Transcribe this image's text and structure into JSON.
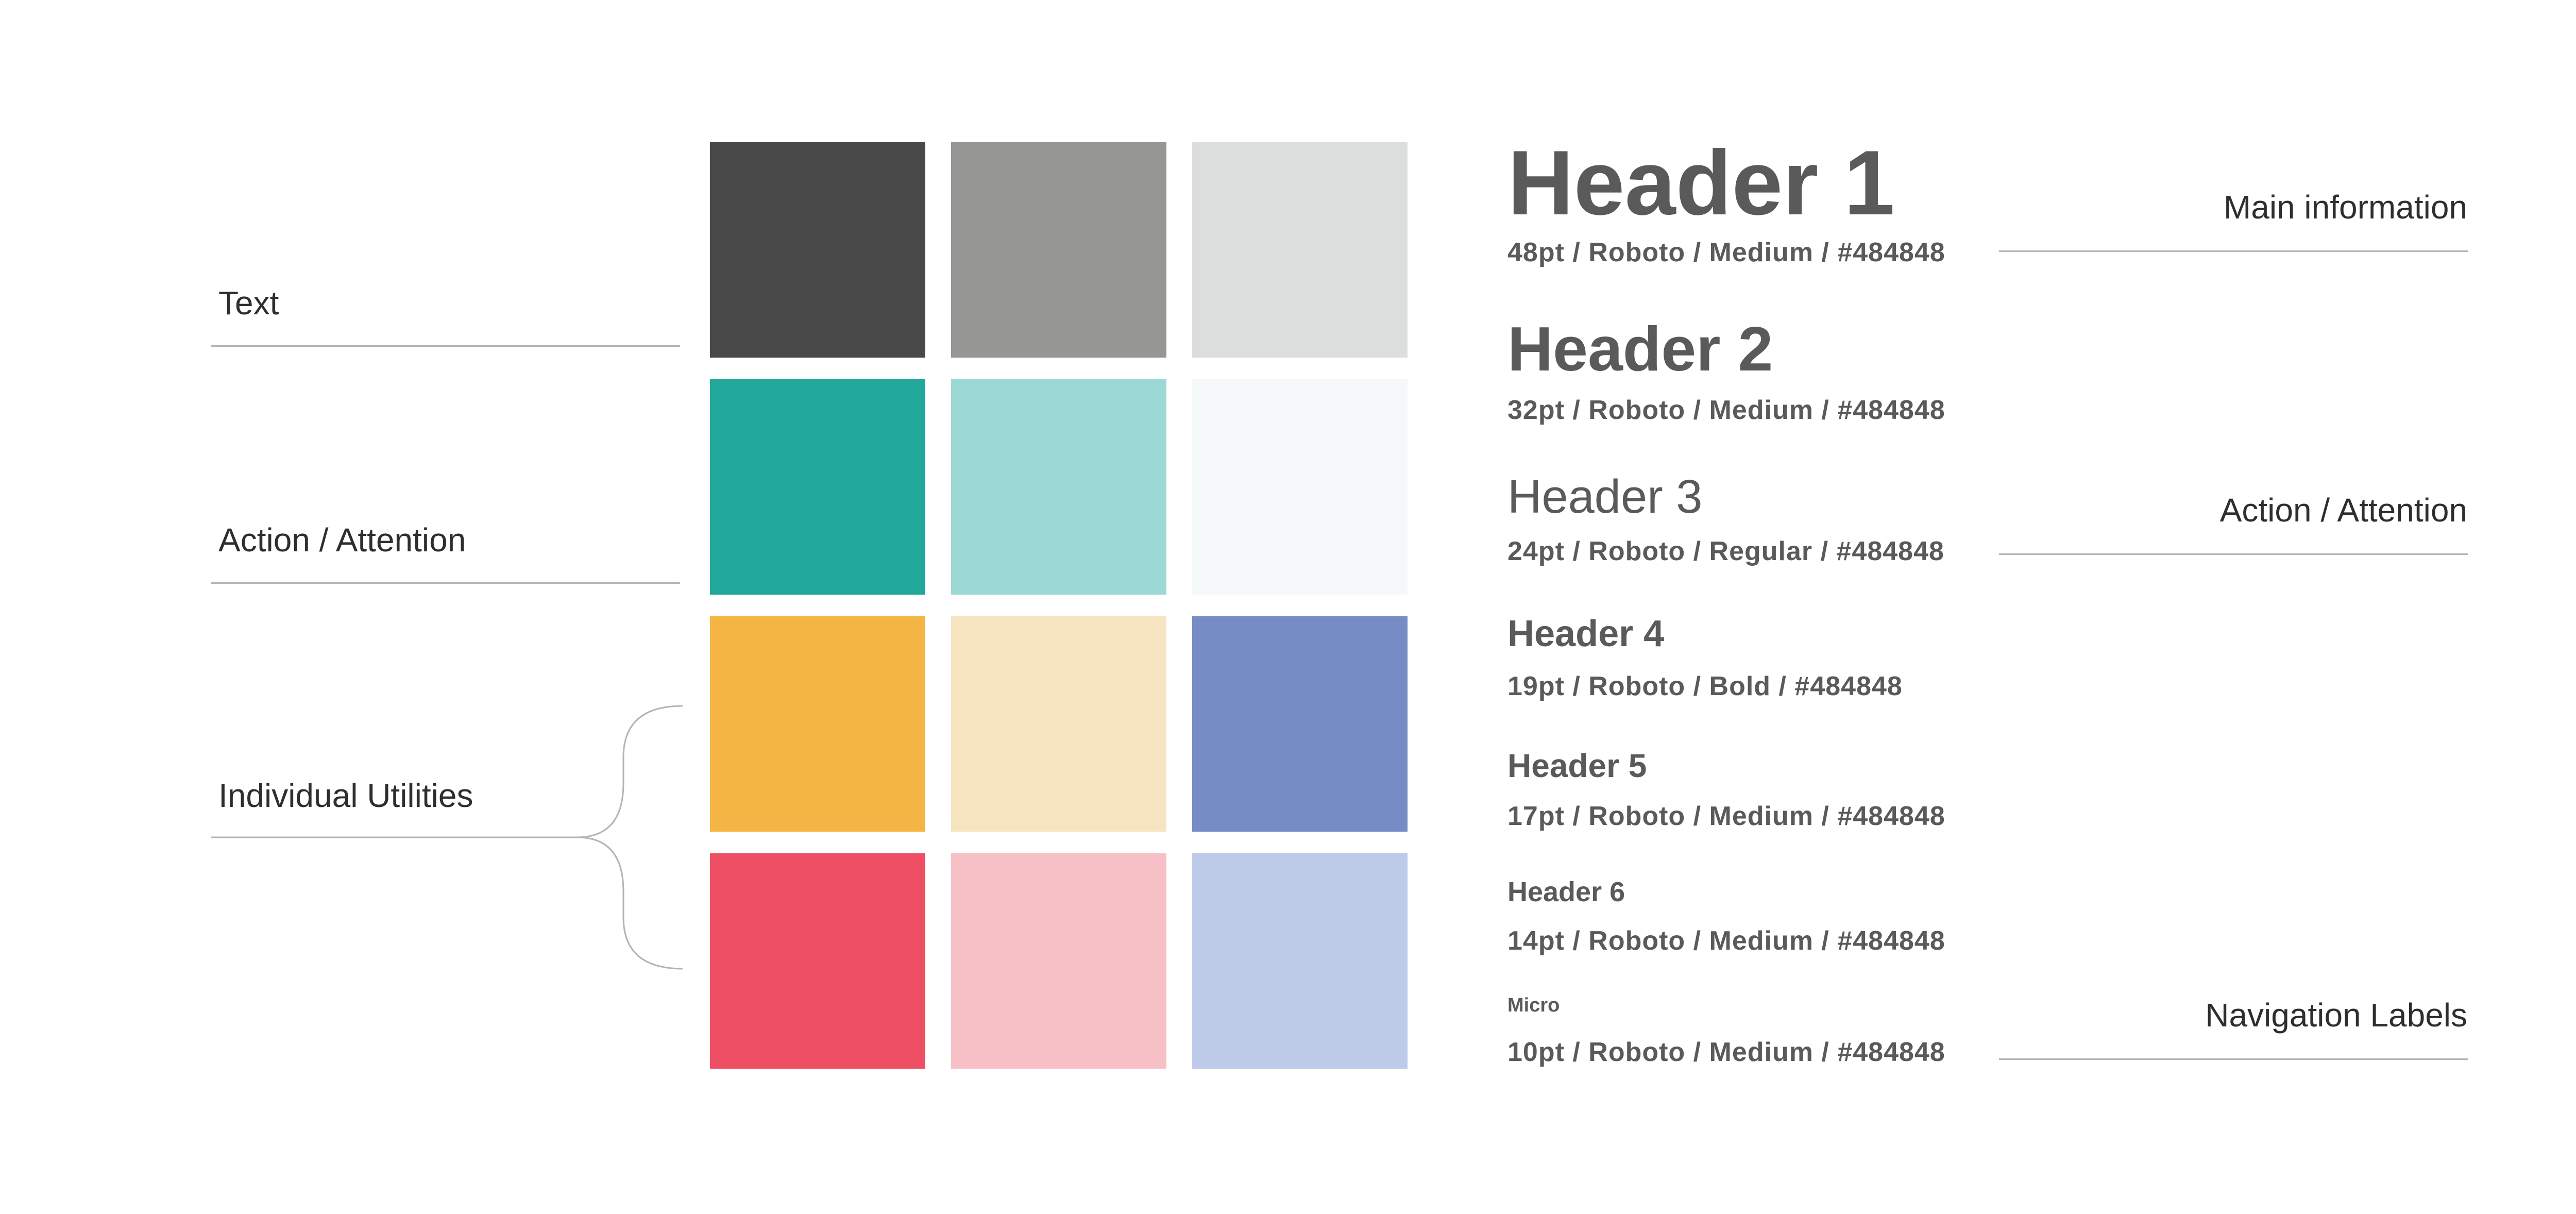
{
  "color_groups": {
    "text_label": "Text",
    "action_label": "Action / Attention",
    "utilities_label": "Individual Utilities"
  },
  "swatches": [
    [
      "#494949",
      "#969695",
      "#dcdedd"
    ],
    [
      "#22a89b",
      "#9cd9d6",
      "#f5f9f9"
    ],
    [
      "#f5b544",
      "#f6e5c0",
      "#758dc4"
    ],
    [
      "#ef4f64",
      "#f7c0c6",
      "#becbe8"
    ]
  ],
  "typography": [
    {
      "sample": "Header 1",
      "meta": "48pt / Roboto / Medium / #484848"
    },
    {
      "sample": "Header 2",
      "meta": "32pt / Roboto / Medium / #484848"
    },
    {
      "sample": "Header 3",
      "meta": "24pt / Roboto / Regular / #484848"
    },
    {
      "sample": "Header 4",
      "meta": "19pt / Roboto / Bold / #484848"
    },
    {
      "sample": "Header 5",
      "meta": "17pt / Roboto / Medium / #484848"
    },
    {
      "sample": "Header 6",
      "meta": "14pt / Roboto / Medium / #484848"
    },
    {
      "sample": "Micro",
      "meta": "10pt / Roboto / Medium / #484848"
    }
  ],
  "usage_labels": {
    "main": "Main information",
    "action": "Action / Attention",
    "navigation": "Navigation Labels"
  }
}
